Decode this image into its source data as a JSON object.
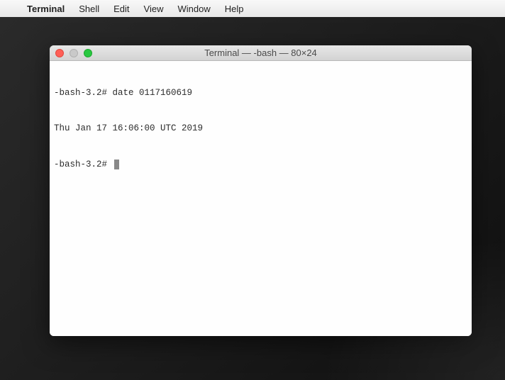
{
  "menubar": {
    "apple": "",
    "app_name": "Terminal",
    "items": [
      "Shell",
      "Edit",
      "View",
      "Window",
      "Help"
    ]
  },
  "window": {
    "title": "Terminal — -bash — 80×24"
  },
  "terminal": {
    "lines": [
      "-bash-3.2# date 0117160619",
      "Thu Jan 17 16:06:00 UTC 2019",
      "-bash-3.2# "
    ]
  }
}
